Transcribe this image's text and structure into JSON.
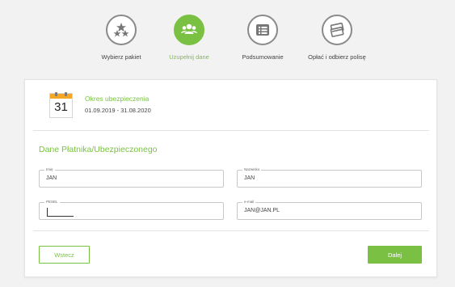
{
  "steps": [
    {
      "label": "Wybierz pakiet",
      "icon": "stars-icon",
      "active": false
    },
    {
      "label": "Uzupełnij dane",
      "icon": "users-icon",
      "active": true
    },
    {
      "label": "Podsumowanie",
      "icon": "list-icon",
      "active": false
    },
    {
      "label": "Opłać i odbierz polisę",
      "icon": "cards-icon",
      "active": false
    }
  ],
  "period": {
    "calendar_day": "31",
    "title": "Okres ubezpieczenia",
    "dates": "01.09.2019 - 31.08.2020"
  },
  "section_title": "Dane Płatnika/Ubezpieczonego",
  "fields": {
    "imie": {
      "label": "Imię",
      "value": "JAN"
    },
    "nazwisko": {
      "label": "Nazwisko",
      "value": "JAN"
    },
    "pesel": {
      "label": "PESEL",
      "value": ""
    },
    "email": {
      "label": "e-mail",
      "value": "JAN@JAN.PL"
    }
  },
  "buttons": {
    "back": "Wstecz",
    "next": "Dalej"
  },
  "colors": {
    "accent": "#7ac143",
    "calendar": "#f5a623",
    "inactive_icon": "#8a8a8a"
  }
}
